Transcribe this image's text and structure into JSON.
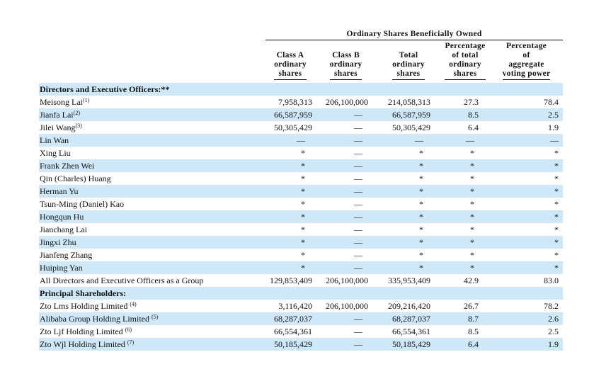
{
  "table": {
    "group_header": "Ordinary Shares Beneficially Owned",
    "columns": [
      "Class A ordinary shares",
      "Class B ordinary shares",
      "Total ordinary shares",
      "Percentage of total ordinary shares",
      "Percentage of aggregate voting power"
    ],
    "column_lines": [
      [
        "Class A",
        "ordinary",
        "shares"
      ],
      [
        "Class B",
        "ordinary",
        "shares"
      ],
      [
        "Total",
        "ordinary",
        "shares"
      ],
      [
        "Percentage",
        "of total",
        "ordinary",
        "shares"
      ],
      [
        "Percentage",
        "of",
        "aggregate",
        "voting power"
      ]
    ],
    "rows": [
      {
        "type": "section",
        "label": "Directors and Executive Officers:**"
      },
      {
        "name": "Meisong Lai",
        "note": "(1)",
        "cells": [
          "7,958,313",
          "206,100,000",
          "214,058,313",
          "27.3",
          "78.4"
        ]
      },
      {
        "name": "Jianfa Lai",
        "note": "(2)",
        "cells": [
          "66,587,959",
          "—",
          "66,587,959",
          "8.5",
          "2.5"
        ]
      },
      {
        "name": "Jilei Wang",
        "note": "(3)",
        "cells": [
          "50,305,429",
          "—",
          "50,305,429",
          "6.4",
          "1.9"
        ]
      },
      {
        "name": "Lin Wan",
        "note": "",
        "cells": [
          "—",
          "—",
          "—",
          "—",
          "—"
        ]
      },
      {
        "name": "Xing Liu",
        "note": "",
        "cells": [
          "*",
          "—",
          "*",
          "*",
          "*"
        ]
      },
      {
        "name": "Frank Zhen Wei",
        "note": "",
        "cells": [
          "*",
          "—",
          "*",
          "*",
          "*"
        ]
      },
      {
        "name": "Qin (Charles) Huang",
        "note": "",
        "cells": [
          "*",
          "—",
          "*",
          "*",
          "*"
        ]
      },
      {
        "name": "Herman Yu",
        "note": "",
        "cells": [
          "*",
          "—",
          "*",
          "*",
          "*"
        ]
      },
      {
        "name": "Tsun-Ming (Daniel) Kao",
        "note": "",
        "cells": [
          "*",
          "—",
          "*",
          "*",
          "*"
        ]
      },
      {
        "name": "Hongqun Hu",
        "note": "",
        "cells": [
          "*",
          "—",
          "*",
          "*",
          "*"
        ]
      },
      {
        "name": "Jianchang Lai",
        "note": "",
        "cells": [
          "*",
          "—",
          "*",
          "*",
          "*"
        ]
      },
      {
        "name": "Jingxi Zhu",
        "note": "",
        "cells": [
          "*",
          "—",
          "*",
          "*",
          "*"
        ]
      },
      {
        "name": "Jianfeng Zhang",
        "note": "",
        "cells": [
          "*",
          "—",
          "*",
          "*",
          "*"
        ]
      },
      {
        "name": "Huiping Yan",
        "note": "",
        "cells": [
          "*",
          "—",
          "*",
          "*",
          "*"
        ]
      },
      {
        "name": "All Directors and Executive Officers as a Group",
        "note": "",
        "cells": [
          "129,853,409",
          "206,100,000",
          "335,953,409",
          "42.9",
          "83.0"
        ]
      },
      {
        "type": "section",
        "label": "Principal Shareholders:"
      },
      {
        "name": "Zto Lms Holding Limited ",
        "note": "(4)",
        "cells": [
          "3,116,420",
          "206,100,000",
          "209,216,420",
          "26.7",
          "78.2"
        ]
      },
      {
        "name": "Alibaba Group Holding Limited ",
        "note": "(5)",
        "cells": [
          "68,287,037",
          "—",
          "68,287,037",
          "8.7",
          "2.6"
        ]
      },
      {
        "name": "Zto Ljf Holding Limited ",
        "note": "(6)",
        "cells": [
          "66,554,361",
          "—",
          "66,554,361",
          "8.5",
          "2.5"
        ]
      },
      {
        "name": "Zto Wjl Holding Limited ",
        "note": "(7)",
        "cells": [
          "50,185,429",
          "—",
          "50,185,429",
          "6.4",
          "1.9"
        ]
      }
    ]
  }
}
